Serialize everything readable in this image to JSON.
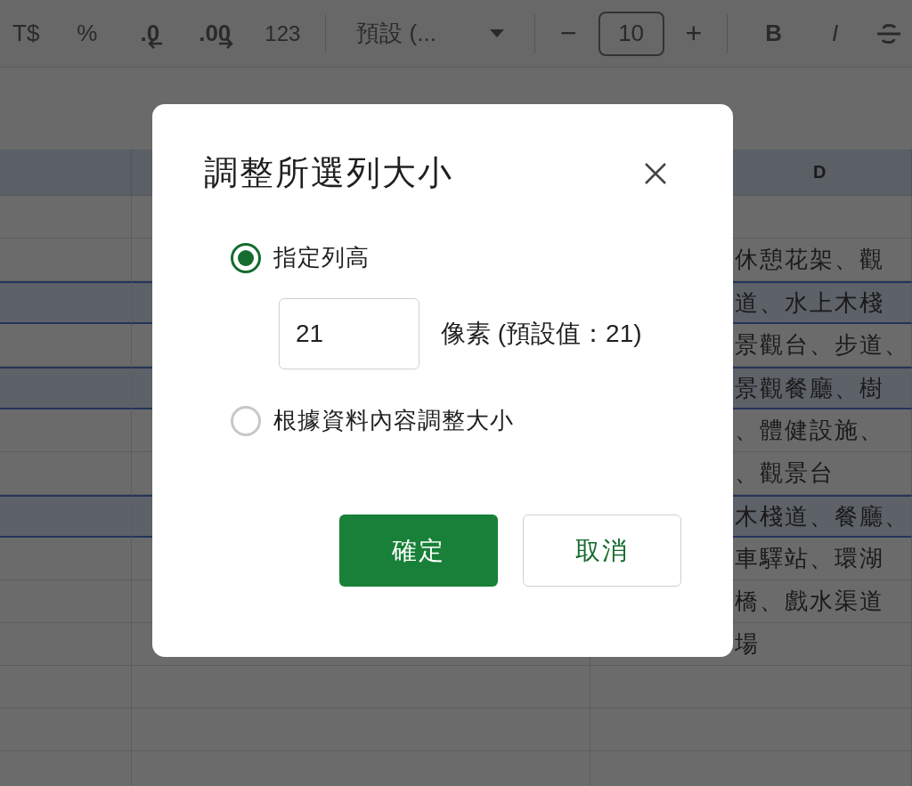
{
  "toolbar": {
    "currency": "T$",
    "percent": "%",
    "decrease_decimals": ".0",
    "increase_decimals": ".00",
    "more_formats": "123",
    "font": "預設 (...",
    "font_size_minus": "−",
    "font_size": "10",
    "font_size_plus": "+",
    "bold": "B",
    "italic": "I"
  },
  "sheet": {
    "column_header": "D",
    "rows": [
      {
        "selected": false,
        "cell_d": ""
      },
      {
        "selected": false,
        "cell_d": "休憩花架、觀"
      },
      {
        "selected": true,
        "cell_d": "道、水上木棧"
      },
      {
        "selected": false,
        "cell_d": "景觀台、步道、"
      },
      {
        "selected": true,
        "cell_d": "景觀餐廳、樹"
      },
      {
        "selected": false,
        "cell_d": "、體健設施、"
      },
      {
        "selected": false,
        "cell_d": "、觀景台"
      },
      {
        "selected": true,
        "cell_d": "木棧道、餐廳、"
      },
      {
        "selected": false,
        "cell_d": "車驛站、環湖"
      },
      {
        "selected": false,
        "cell_d": "橋、戲水渠道"
      },
      {
        "selected": false,
        "cell_d": "場"
      },
      {
        "selected": false,
        "cell_d": ""
      },
      {
        "selected": false,
        "cell_d": ""
      },
      {
        "selected": false,
        "cell_d": ""
      }
    ]
  },
  "dialog": {
    "title": "調整所選列大小",
    "options": [
      {
        "label": "指定列高",
        "selected": true
      },
      {
        "label": "根據資料內容調整大小",
        "selected": false
      }
    ],
    "height_input": {
      "value": "21"
    },
    "unit": "像素 (預設值：21)",
    "buttons": [
      {
        "label": "確定",
        "kind": "primary"
      },
      {
        "label": "取消",
        "kind": "secondary"
      }
    ]
  }
}
